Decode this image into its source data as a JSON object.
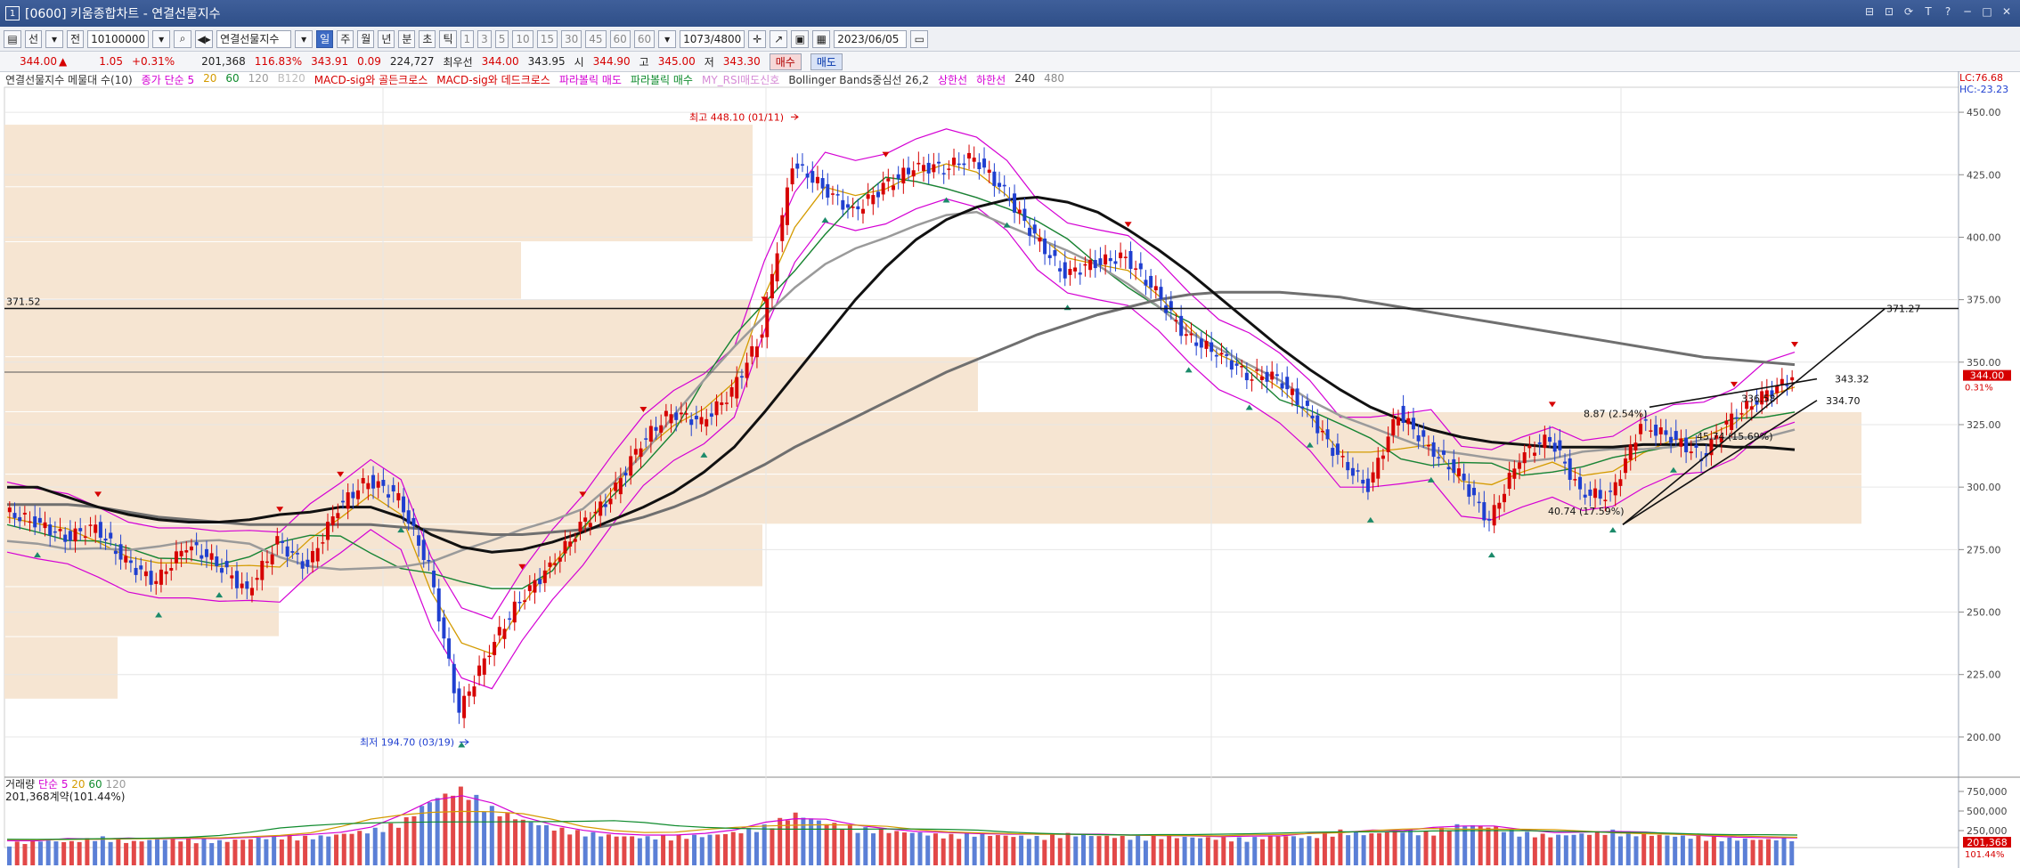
{
  "window": {
    "title": "[0600] 키움종합차트 - 연결선물지수",
    "controls": [
      "⊟",
      "⊡",
      "⟳",
      "T",
      "?",
      "─",
      "□",
      "✕"
    ]
  },
  "toolbar": {
    "mode_selected": "선",
    "tabs_left": [
      "선",
      "전"
    ],
    "code": "10100000",
    "name": "연결선물지수",
    "periods": [
      "일",
      "주",
      "월",
      "년",
      "분",
      "초",
      "틱"
    ],
    "minutes": [
      "1",
      "3",
      "5",
      "10",
      "15",
      "30",
      "45",
      "60",
      "60"
    ],
    "count": "1073",
    "count_total": "/4800",
    "date": "2023/06/05"
  },
  "quote": {
    "price": "344.00",
    "arrow": "▲",
    "change": "1.05",
    "change_pct": "+0.31%",
    "volume": "201,368",
    "vol_ratio": "116.83%",
    "bid": "343.91",
    "bid_diff": "0.09",
    "oi": "224,727",
    "ask_label": "최우선",
    "ask1": "344.00",
    "ask2": "343.95",
    "open_label": "시",
    "open": "344.90",
    "high_label": "고",
    "high": "345.00",
    "low_label": "저",
    "low": "343.30",
    "buy_label": "매수",
    "sell_label": "매도"
  },
  "legend": {
    "items": [
      {
        "text": "연결선물지수 메물대 수(10)",
        "color": "#333333"
      },
      {
        "text": "종가 단순 5",
        "color": "#d400d4"
      },
      {
        "text": "20",
        "color": "#d49b00"
      },
      {
        "text": "60",
        "color": "#0f8b2d"
      },
      {
        "text": "120",
        "color": "#9a9a9a"
      },
      {
        "text": "B120",
        "color": "#bbbbbb"
      },
      {
        "text": "MACD-sig와 골든크로스",
        "color": "#d60000"
      },
      {
        "text": "MACD-sig와 데드크로스",
        "color": "#d60000"
      },
      {
        "text": "파라볼릭 매도",
        "color": "#d400d4"
      },
      {
        "text": "파라볼릭 매수",
        "color": "#0f8b2d"
      },
      {
        "text": "MY_RSI매도신호",
        "color": "#d68bd6"
      },
      {
        "text": "Bollinger Bands중심선 26,2",
        "color": "#333333"
      },
      {
        "text": "상한선",
        "color": "#d400d4"
      },
      {
        "text": "하한선",
        "color": "#d400d4"
      },
      {
        "text": "240",
        "color": "#333333"
      },
      {
        "text": "480",
        "color": "#888888"
      }
    ]
  },
  "right_header": {
    "lc": "LC:76.68",
    "hc": "HC:-23.23"
  },
  "price_axis": [
    "450.00",
    "425.00",
    "400.00",
    "375.00",
    "350.00",
    "325.00",
    "300.00",
    "275.00",
    "250.00",
    "225.00",
    "200.00"
  ],
  "price_tag": {
    "value": "344.00",
    "pct": "0.31%"
  },
  "annotations": {
    "max_label": "최고 448.10 (01/11)",
    "min_label": "최저 194.70 (03/19)",
    "hline_left": "371.52",
    "hline_right": "371.27",
    "trend1": "343.32",
    "trend2": "334.70",
    "note_a": "8.87 (2.54%)",
    "note_b": "45.74 (15.69%)",
    "note_c": "336.58",
    "note_d": "40.74 (17.59%)"
  },
  "volume": {
    "legend_title": "거래량",
    "legend_items": [
      {
        "text": "단순 5",
        "color": "#d400d4"
      },
      {
        "text": "20",
        "color": "#d49b00"
      },
      {
        "text": "60",
        "color": "#0f8b2d"
      },
      {
        "text": "120",
        "color": "#9a9a9a"
      }
    ],
    "info": "201,368계약(101.44%)",
    "axis": [
      "750,000",
      "500,000",
      "250,000"
    ],
    "tag": "201,368",
    "tag_pct": "101.44%"
  },
  "colors": {
    "up": "#d60000",
    "down": "#1f3fd0",
    "vp_fill": "#f6e5d2",
    "bg": "#ffffff"
  },
  "chart_data": {
    "type": "line",
    "title": "",
    "ylim": [
      185,
      460
    ],
    "series": [
      {
        "name": "",
        "values": [
          290,
          286,
          280,
          284,
          270,
          262,
          277,
          270,
          258,
          278,
          268,
          292,
          303,
          296,
          268,
          210,
          235,
          255,
          268,
          284,
          296,
          318,
          330,
          326,
          338,
          362,
          430,
          420,
          410,
          420,
          428,
          428,
          432,
          418,
          400,
          385,
          390,
          392,
          378,
          360,
          354,
          345,
          344,
          330,
          312,
          300,
          330,
          316,
          305,
          286,
          312,
          320,
          298,
          296,
          325,
          320,
          312,
          328,
          336,
          344
        ]
      },
      {
        "name": "240",
        "values": [
          300,
          300,
          296,
          292,
          289,
          287,
          286,
          286,
          287,
          289,
          290,
          292,
          292,
          288,
          281,
          276,
          274,
          275,
          278,
          282,
          287,
          292,
          298,
          306,
          316,
          330,
          345,
          360,
          375,
          388,
          399,
          407,
          412,
          415,
          416,
          414,
          410,
          403,
          395,
          386,
          376,
          366,
          356,
          347,
          339,
          332,
          327,
          323,
          320,
          318,
          317,
          316,
          316,
          316,
          317,
          317,
          317,
          316,
          316,
          315
        ]
      },
      {
        "name": "480",
        "values": [
          293,
          293,
          293,
          292,
          290,
          288,
          287,
          286,
          285,
          285,
          285,
          285,
          285,
          284,
          283,
          282,
          281,
          281,
          282,
          283,
          285,
          288,
          292,
          297,
          303,
          309,
          316,
          322,
          328,
          334,
          340,
          346,
          351,
          356,
          361,
          365,
          369,
          372,
          375,
          377,
          378,
          378,
          378,
          377,
          376,
          374,
          372,
          370,
          368,
          366,
          364,
          362,
          360,
          358,
          356,
          354,
          352,
          351,
          350,
          349
        ]
      }
    ],
    "volume_values": [
      0.28,
      0.32,
      0.3,
      0.36,
      0.3,
      0.34,
      0.33,
      0.31,
      0.34,
      0.37,
      0.36,
      0.4,
      0.45,
      0.55,
      0.85,
      0.98,
      0.72,
      0.58,
      0.48,
      0.42,
      0.38,
      0.36,
      0.37,
      0.38,
      0.42,
      0.5,
      0.66,
      0.55,
      0.48,
      0.44,
      0.42,
      0.38,
      0.4,
      0.38,
      0.36,
      0.4,
      0.38,
      0.36,
      0.37,
      0.36,
      0.35,
      0.34,
      0.38,
      0.36,
      0.44,
      0.4,
      0.45,
      0.42,
      0.52,
      0.5,
      0.42,
      0.38,
      0.4,
      0.44,
      0.4,
      0.38,
      0.36,
      0.34,
      0.33,
      0.34
    ]
  }
}
